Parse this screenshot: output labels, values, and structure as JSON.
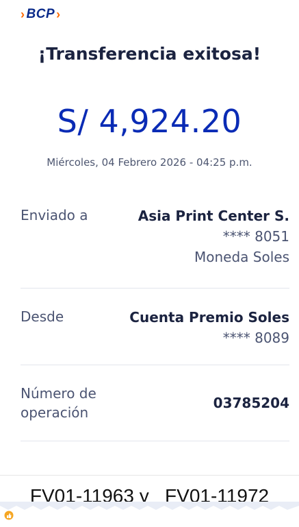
{
  "brand": {
    "name": "BCP"
  },
  "header": {
    "title": "¡Transferencia exitosa!"
  },
  "transfer": {
    "amount": "S/ 4,924.20",
    "datetime": "Miércoles, 04 Febrero 2026 - 04:25 p.m."
  },
  "details": {
    "sent_to": {
      "label": "Enviado a",
      "name": "Asia Print Center S.",
      "account": "**** 8051",
      "currency": "Moneda Soles"
    },
    "from": {
      "label": "Desde",
      "account_name": "Cuenta Premio Soles",
      "account": "**** 8089"
    },
    "operation": {
      "label_line1": "Número de",
      "label_line2": "operación",
      "number": "03785204"
    }
  },
  "caption": {
    "text": "FV01-11963 y   FV01-11972"
  },
  "colors": {
    "brand_blue": "#0a2a8a",
    "brand_orange": "#ff6a00",
    "amount_blue": "#0a2bb5"
  }
}
